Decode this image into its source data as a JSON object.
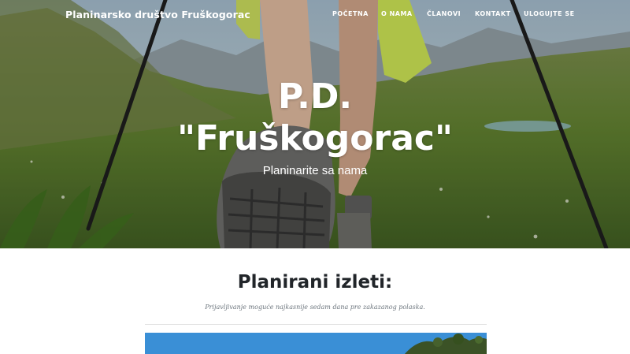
{
  "navbar": {
    "brand": "Planinarsko društvo Fruškogorac",
    "links": [
      {
        "label": "POČETNA"
      },
      {
        "label": "O NAMA"
      },
      {
        "label": "ČLANOVI"
      },
      {
        "label": "KONTAKT"
      },
      {
        "label": "ULOGUJTE SE"
      }
    ]
  },
  "hero": {
    "title_line1": "P.D.",
    "title_line2": "\"Fruškogorac\"",
    "subtitle": "Planinarite sa nama"
  },
  "trips": {
    "heading": "Planirani izleti:",
    "note": "Prijavljivanje moguće najkasnije sedam dana pre zakazanog polaska."
  }
}
